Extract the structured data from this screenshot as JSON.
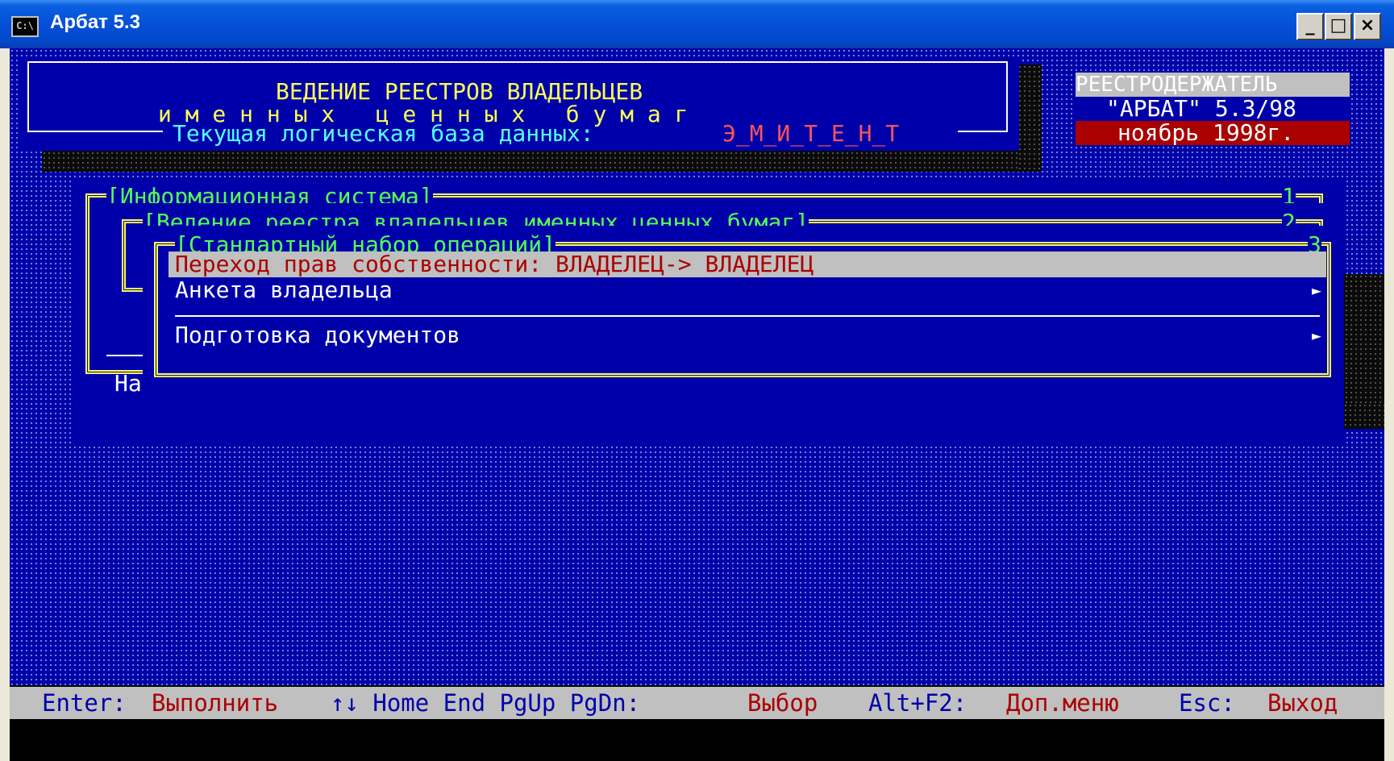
{
  "window": {
    "title": "Арбат 5.3",
    "icon": "console-icon",
    "controls": {
      "minimize": "_",
      "maximize": "□",
      "close": "×"
    }
  },
  "header": {
    "title_line1": "ВЕДЕНИЕ РЕЕСТРОВ ВЛАДЕЛЬЦЕВ",
    "title_line2": "и м е н н ы х   ц е н н ы х   б у м а г",
    "db_label": "Текущая логическая база данных:",
    "db_name": "Э_М_И_Т_Е_Н_Т"
  },
  "badge": {
    "line1": "РЕЕСТРОДЕРЖАТЕЛЬ",
    "line2": "\"АРБАТ\" 5.3/98",
    "line3": "ноябрь 1998г."
  },
  "menus": {
    "level1": {
      "title": "[Информационная система]",
      "num": "1"
    },
    "level2": {
      "title": "[Ведение реестра владельцев именных ценных бумаг]",
      "num": "2"
    },
    "level3": {
      "title": "[Стандартный набор операций]",
      "num": "3",
      "items": [
        {
          "label": "Переход прав собственности: ВЛАДЕЛЕЦ-> ВЛАДЕЛЕЦ",
          "selected": true,
          "submenu": false
        },
        {
          "label": "Анкета владельца",
          "selected": false,
          "submenu": true
        },
        {
          "label": "Подготовка документов",
          "selected": false,
          "submenu": true
        }
      ],
      "submenu_marker": "►"
    },
    "hidden_fragment": "На"
  },
  "statusbar": {
    "enter_key": "Enter:",
    "enter_action": "Выполнить",
    "nav_keys": "↑↓ Home End PgUp PgDn:",
    "nav_action": "Выбор",
    "alt_key": "Alt+F2:",
    "alt_action": "Доп.меню",
    "esc_key": "Esc:",
    "esc_action": "Выход"
  },
  "colors": {
    "background": "#0000a8",
    "highlight": "#c0c0c0",
    "accent_red": "#aa0000",
    "frame_yellow": "#ffff54"
  }
}
